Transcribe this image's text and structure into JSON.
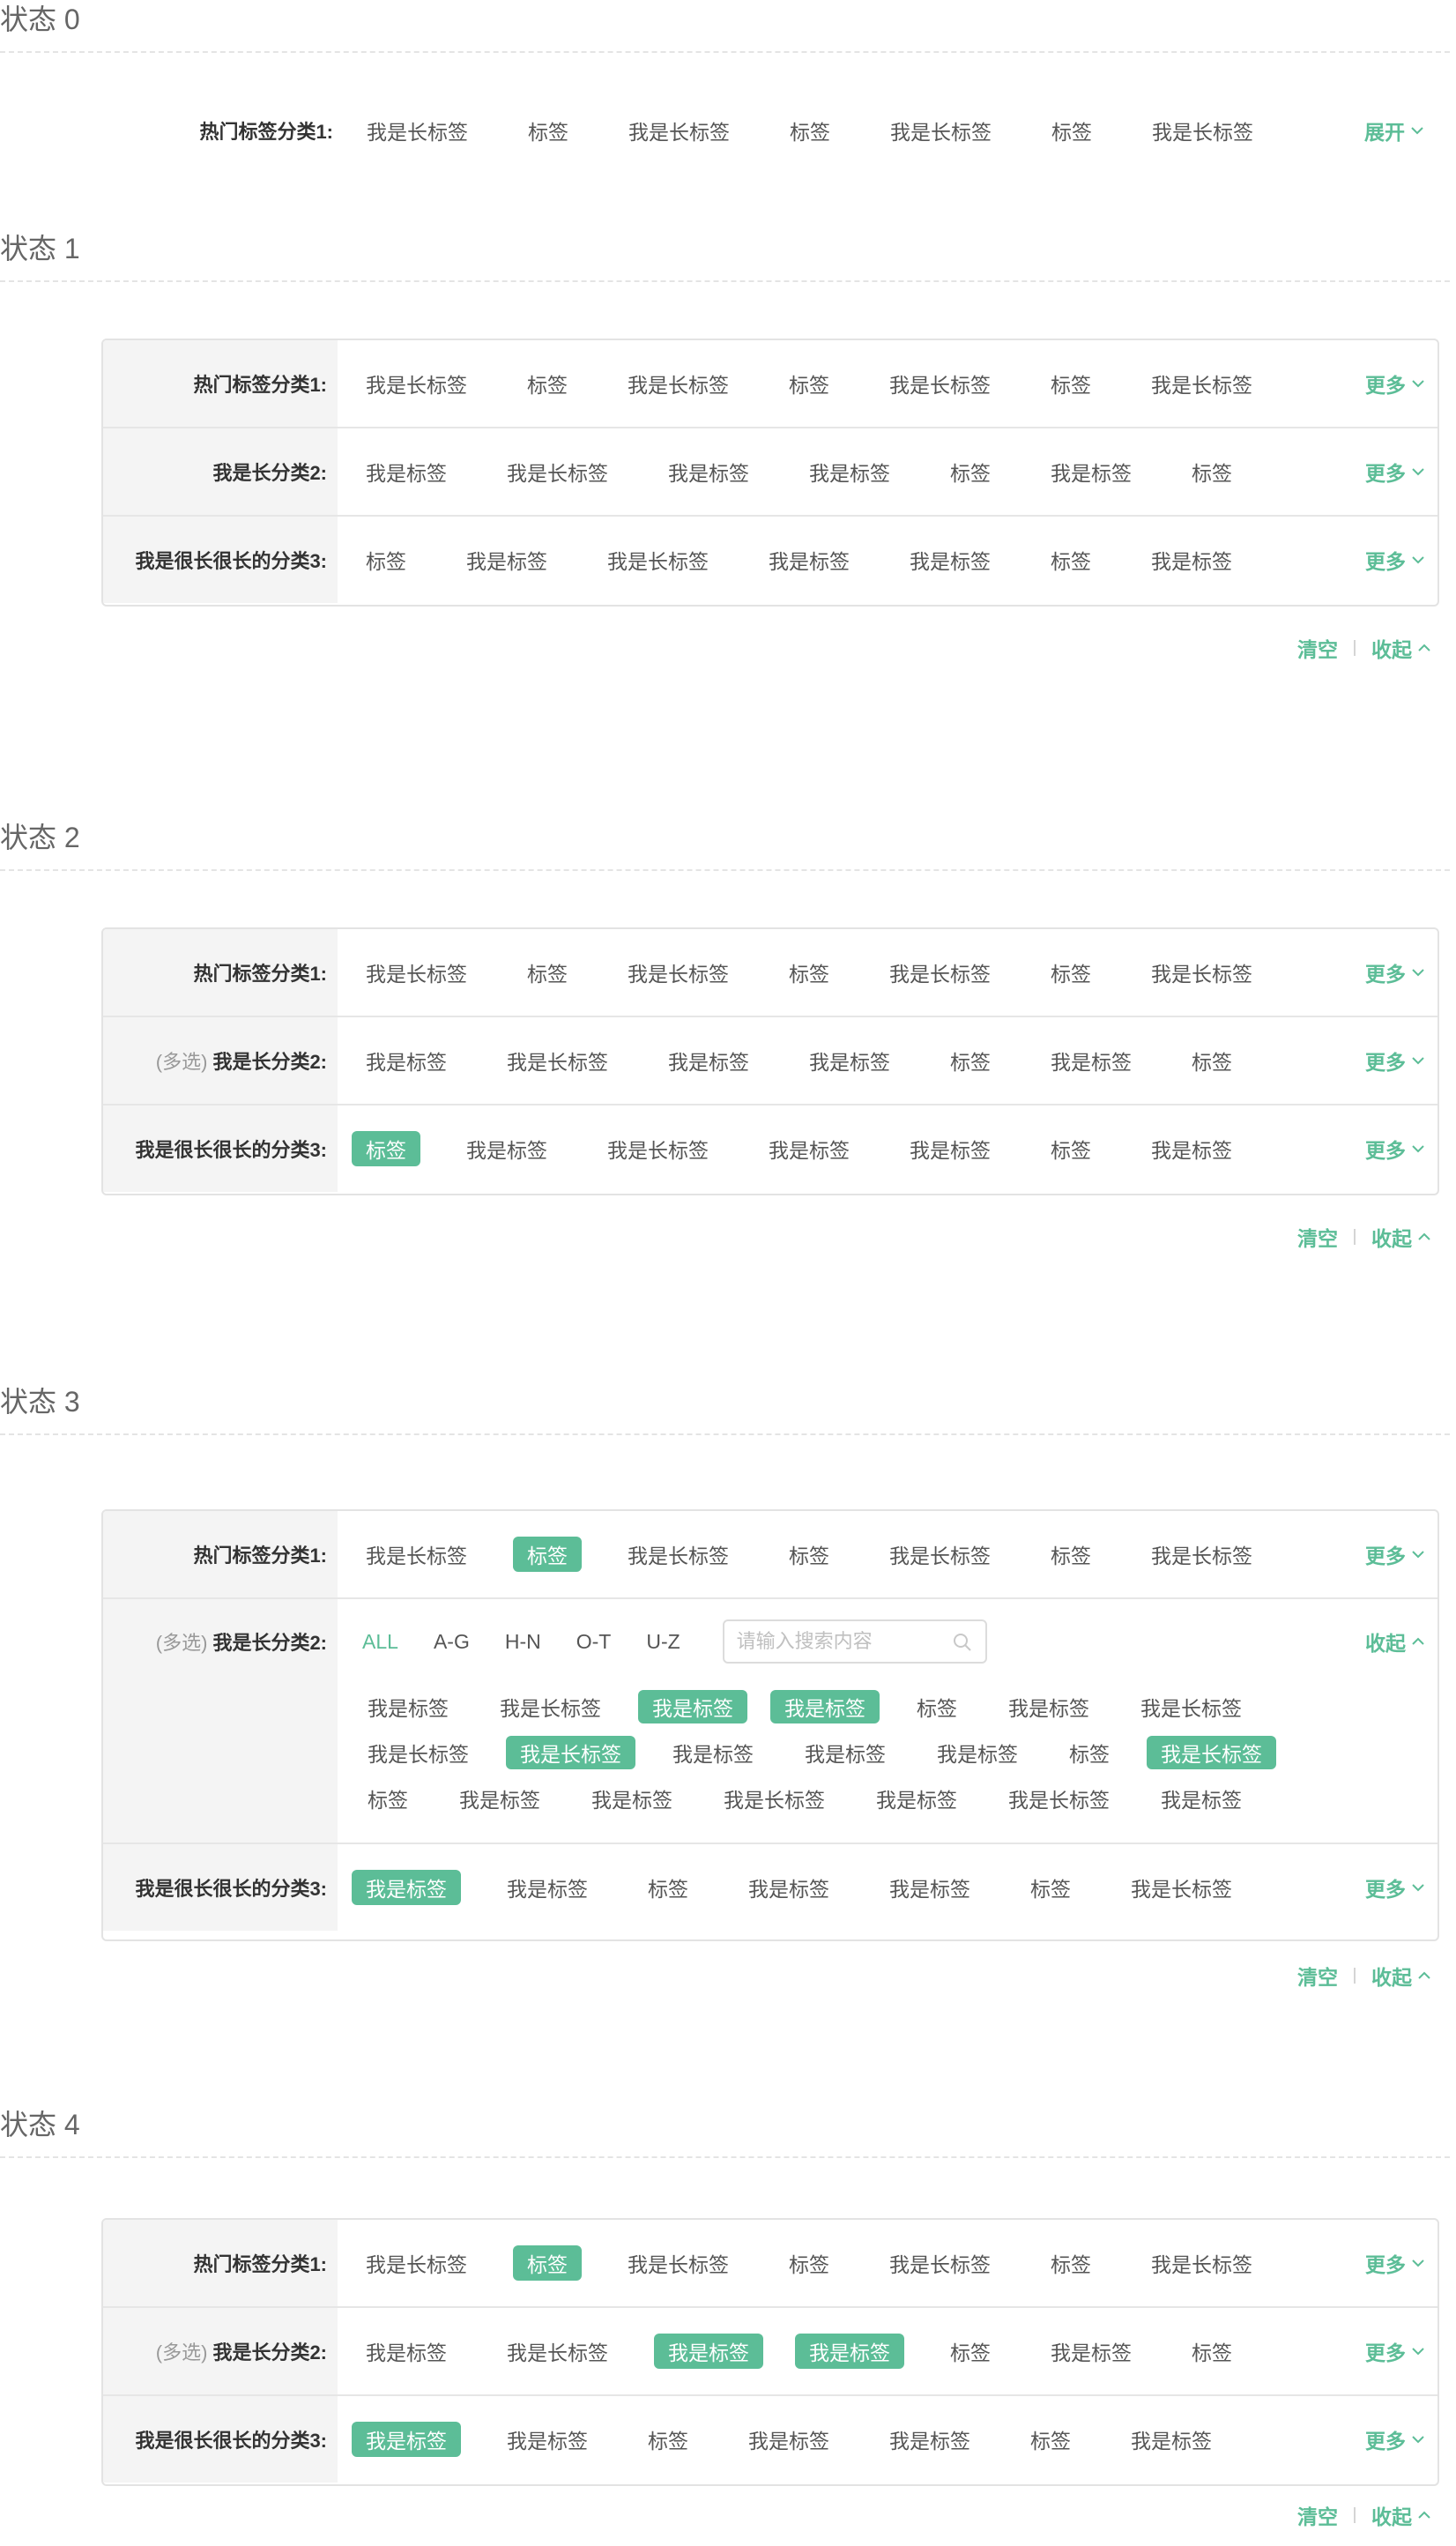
{
  "colors": {
    "accent": "#5cbd97",
    "label_bg": "#f4f4f4",
    "border": "#e3e3e3",
    "text": "#555555"
  },
  "icons": {
    "more": "chevron-down-icon",
    "collapse": "chevron-up-icon",
    "search": "search-icon"
  },
  "state0": {
    "title": "状态 0",
    "label": "热门标签分类1:",
    "tags": [
      "我是长标签",
      "标签",
      "我是长标签",
      "标签",
      "我是长标签",
      "标签",
      "我是长标签"
    ],
    "expand": "展开"
  },
  "state1": {
    "title": "状态 1",
    "rows": [
      {
        "label": "热门标签分类1:",
        "tags": [
          "我是长标签",
          "标签",
          "我是长标签",
          "标签",
          "我是长标签",
          "标签",
          "我是长标签"
        ],
        "more": "更多"
      },
      {
        "label": "我是长分类2:",
        "tags": [
          "我是标签",
          "我是长标签",
          "我是标签",
          "我是标签",
          "标签",
          "我是标签",
          "标签"
        ],
        "more": "更多"
      },
      {
        "label": "我是很长很长的分类3:",
        "tags": [
          "标签",
          "我是标签",
          "我是长标签",
          "我是标签",
          "我是标签",
          "标签",
          "我是标签"
        ],
        "more": "更多"
      }
    ],
    "clear": "清空",
    "collapse": "收起"
  },
  "state2": {
    "title": "状态 2",
    "rows": [
      {
        "label": "热门标签分类1:",
        "tags": [
          "我是长标签",
          "标签",
          "我是长标签",
          "标签",
          "我是长标签",
          "标签",
          "我是长标签"
        ],
        "more": "更多"
      },
      {
        "prefix": "(多选)",
        "label": "我是长分类2:",
        "tags": [
          "我是标签",
          "我是长标签",
          "我是标签",
          "我是标签",
          "标签",
          "我是标签",
          "标签"
        ],
        "more": "更多"
      },
      {
        "label": "我是很长很长的分类3:",
        "tags": [
          "标签",
          "我是标签",
          "我是长标签",
          "我是标签",
          "我是标签",
          "标签",
          "我是标签"
        ],
        "more": "更多"
      }
    ],
    "clear": "清空",
    "collapse": "收起"
  },
  "state3": {
    "title": "状态 3",
    "row1": {
      "label": "热门标签分类1:",
      "tags": [
        "我是长标签",
        "标签",
        "我是长标签",
        "标签",
        "我是长标签",
        "标签",
        "我是长标签"
      ],
      "more": "更多"
    },
    "row2": {
      "prefix": "(多选)",
      "label": "我是长分类2:",
      "alpha": [
        "ALL",
        "A-G",
        "H-N",
        "O-T",
        "U-Z"
      ],
      "search_placeholder": "请输入搜索内容",
      "collapse": "收起",
      "lines": [
        [
          "我是标签",
          "我是长标签",
          "我是标签",
          "我是标签",
          "标签",
          "我是标签",
          "我是长标签"
        ],
        [
          "我是长标签",
          "我是长标签",
          "我是标签",
          "我是标签",
          "我是标签",
          "标签",
          "我是长标签"
        ],
        [
          "标签",
          "我是标签",
          "我是标签",
          "我是长标签",
          "我是标签",
          "我是长标签",
          "我是标签"
        ]
      ]
    },
    "row3": {
      "label": "我是很长很长的分类3:",
      "tags": [
        "我是标签",
        "我是标签",
        "标签",
        "我是标签",
        "我是标签",
        "标签",
        "我是长标签"
      ],
      "more": "更多"
    },
    "clear": "清空",
    "collapse": "收起"
  },
  "state4": {
    "title": "状态 4",
    "rows": [
      {
        "label": "热门标签分类1:",
        "tags": [
          "我是长标签",
          "标签",
          "我是长标签",
          "标签",
          "我是长标签",
          "标签",
          "我是长标签"
        ],
        "more": "更多"
      },
      {
        "prefix": "(多选)",
        "label": "我是长分类2:",
        "tags": [
          "我是标签",
          "我是长标签",
          "我是标签",
          "我是标签",
          "标签",
          "我是标签",
          "标签"
        ],
        "more": "更多"
      },
      {
        "label": "我是很长很长的分类3:",
        "tags": [
          "我是标签",
          "我是标签",
          "标签",
          "我是标签",
          "我是标签",
          "标签",
          "我是标签"
        ],
        "more": "更多"
      }
    ],
    "clear": "清空",
    "collapse": "收起"
  }
}
